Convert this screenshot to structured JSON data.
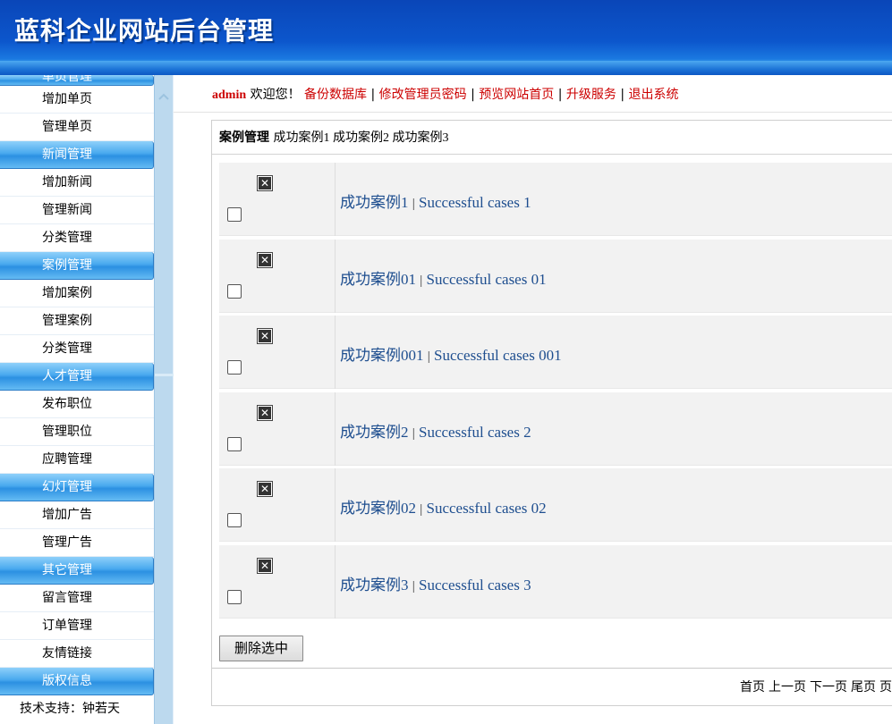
{
  "header": {
    "title": "蓝科企业网站后台管理"
  },
  "sidebar": {
    "sections": [
      {
        "label": "单页管理",
        "items": [
          "增加单页",
          "管理单页"
        ]
      },
      {
        "label": "新闻管理",
        "items": [
          "增加新闻",
          "管理新闻",
          "分类管理"
        ]
      },
      {
        "label": "案例管理",
        "items": [
          "增加案例",
          "管理案例",
          "分类管理"
        ]
      },
      {
        "label": "人才管理",
        "items": [
          "发布职位",
          "管理职位",
          "应聘管理"
        ]
      },
      {
        "label": "幻灯管理",
        "items": [
          "增加广告",
          "管理广告"
        ]
      },
      {
        "label": "其它管理",
        "items": [
          "留言管理",
          "订单管理",
          "友情链接"
        ]
      },
      {
        "label": "版权信息",
        "items": []
      }
    ],
    "support": "技术支持：钟若天"
  },
  "topbar": {
    "user": "admin",
    "welcome": " 欢迎您！",
    "links": [
      "备份数据库",
      "修改管理员密码",
      "预览网站首页",
      "升级服务",
      "退出系统"
    ],
    "separator": "|"
  },
  "panel": {
    "heading": "案例管理",
    "crumbs": "成功案例1 成功案例2 成功案例3"
  },
  "cases": [
    {
      "cn": "成功案例1",
      "en": "Successful cases 1"
    },
    {
      "cn": "成功案例01",
      "en": "Successful cases 01"
    },
    {
      "cn": "成功案例001",
      "en": "Successful cases 001"
    },
    {
      "cn": "成功案例2",
      "en": "Successful cases 2"
    },
    {
      "cn": "成功案例02",
      "en": "Successful cases 02"
    },
    {
      "cn": "成功案例3",
      "en": "Successful cases 3"
    }
  ],
  "delete_icon_glyph": "✕",
  "actions": {
    "delete_selected": "删除选中"
  },
  "pager": {
    "first": "首页",
    "prev": "上一页",
    "next": "下一页",
    "last": "尾页",
    "tail": "页"
  },
  "colors": {
    "header_blue": "#0c56cc",
    "link_red": "#cc0000",
    "case_blue": "#1e4e8f",
    "sidebar_cat": "#49a9ee"
  }
}
